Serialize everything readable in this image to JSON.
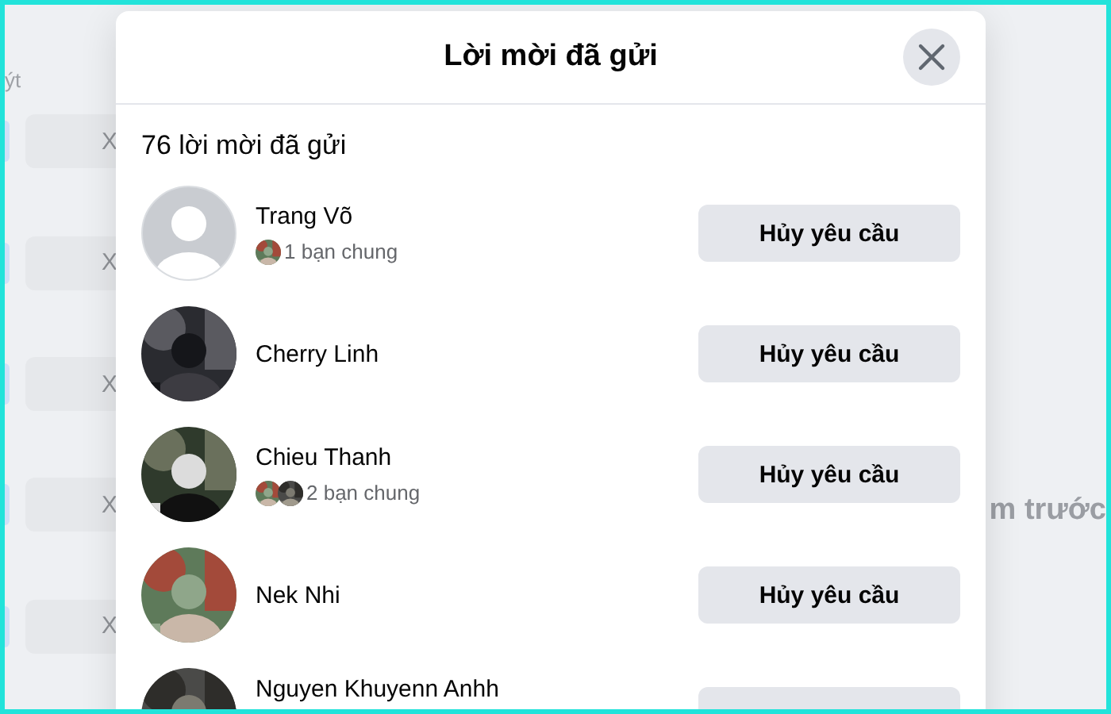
{
  "background": {
    "top_label": "ýt",
    "row_buttons": [
      "X",
      "X",
      "X",
      "X",
      "X"
    ],
    "side_text": "m trước"
  },
  "dialog": {
    "title": "Lời mời đã gửi",
    "count": "76 lời mời đã gửi",
    "requests": [
      {
        "name": "Trang Võ",
        "avatar": {
          "kind": "silhouette"
        },
        "mutual": "1 bạn chung",
        "button": "Hủy yêu cầu"
      },
      {
        "name": "Cherry Linh",
        "button": "Hủy yêu cầu"
      },
      {
        "name": "Chieu Thanh",
        "mutual": "2 bạn chung",
        "button": "Hủy yêu cầu"
      },
      {
        "name": "Nek Nhi",
        "button": "Hủy yêu cầu"
      },
      {
        "name": "Nguyen Khuyenn Anhh"
      }
    ]
  }
}
